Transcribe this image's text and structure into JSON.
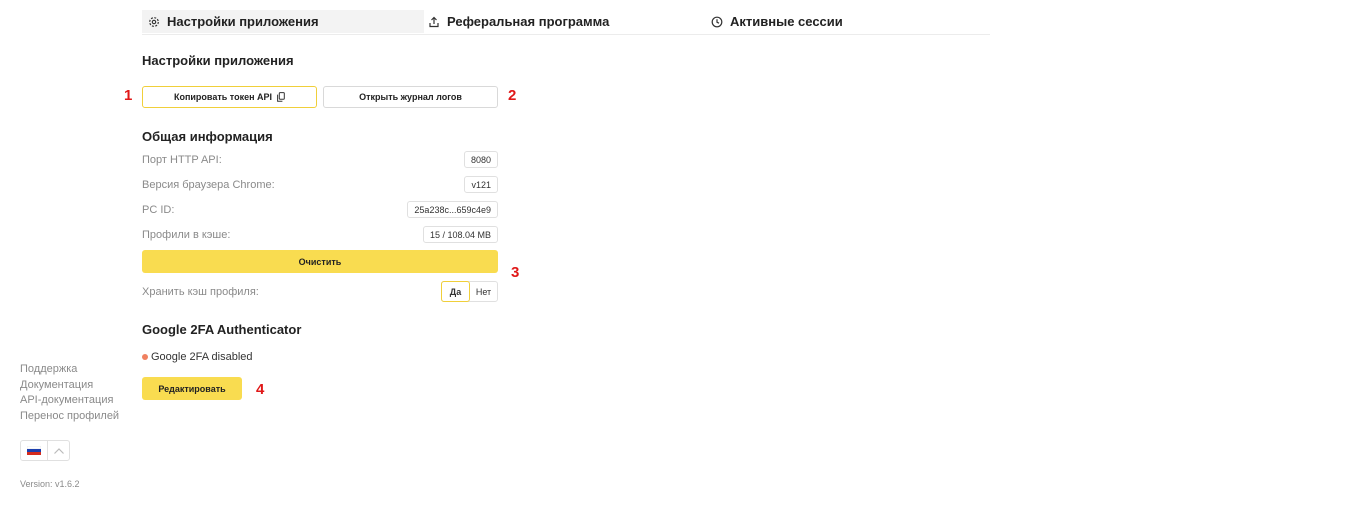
{
  "tabs": [
    {
      "label": "Настройки приложения",
      "icon": "gear-icon",
      "active": true
    },
    {
      "label": "Реферальная программа",
      "icon": "share-icon",
      "active": false
    },
    {
      "label": "Активные сессии",
      "icon": "clock-icon",
      "active": false
    }
  ],
  "settings": {
    "title": "Настройки приложения",
    "copy_token_label": "Копировать токен API",
    "open_logs_label": "Открыть журнал логов"
  },
  "general": {
    "title": "Общая информация",
    "rows": [
      {
        "label": "Порт HTTP API:",
        "value": "8080"
      },
      {
        "label": "Версия браузера Chrome:",
        "value": "v121"
      },
      {
        "label": "PC ID:",
        "value": "25a238c...659c4e9"
      },
      {
        "label": "Профили в кэше:",
        "value": "15 / 108.04 MB"
      }
    ],
    "clear_label": "Очистить",
    "keep_cache_label": "Хранить кэш профиля:",
    "toggle_yes": "Да",
    "toggle_no": "Нет",
    "toggle_selected": "Да"
  },
  "twofa": {
    "title": "Google 2FA Authenticator",
    "status": "Google 2FA disabled",
    "status_color": "#f08060",
    "edit_label": "Редактировать"
  },
  "markers": [
    "1",
    "2",
    "3",
    "4"
  ],
  "sidebar": {
    "links": [
      "Поддержка",
      "Документация",
      "API-документация",
      "Перенос профилей"
    ],
    "language_icon": "russia-flag-icon",
    "version": "Version: v1.6.2"
  },
  "colors": {
    "accent": "#f9dc50",
    "accent_border": "#f0cf3a",
    "marker": "#e01818"
  }
}
